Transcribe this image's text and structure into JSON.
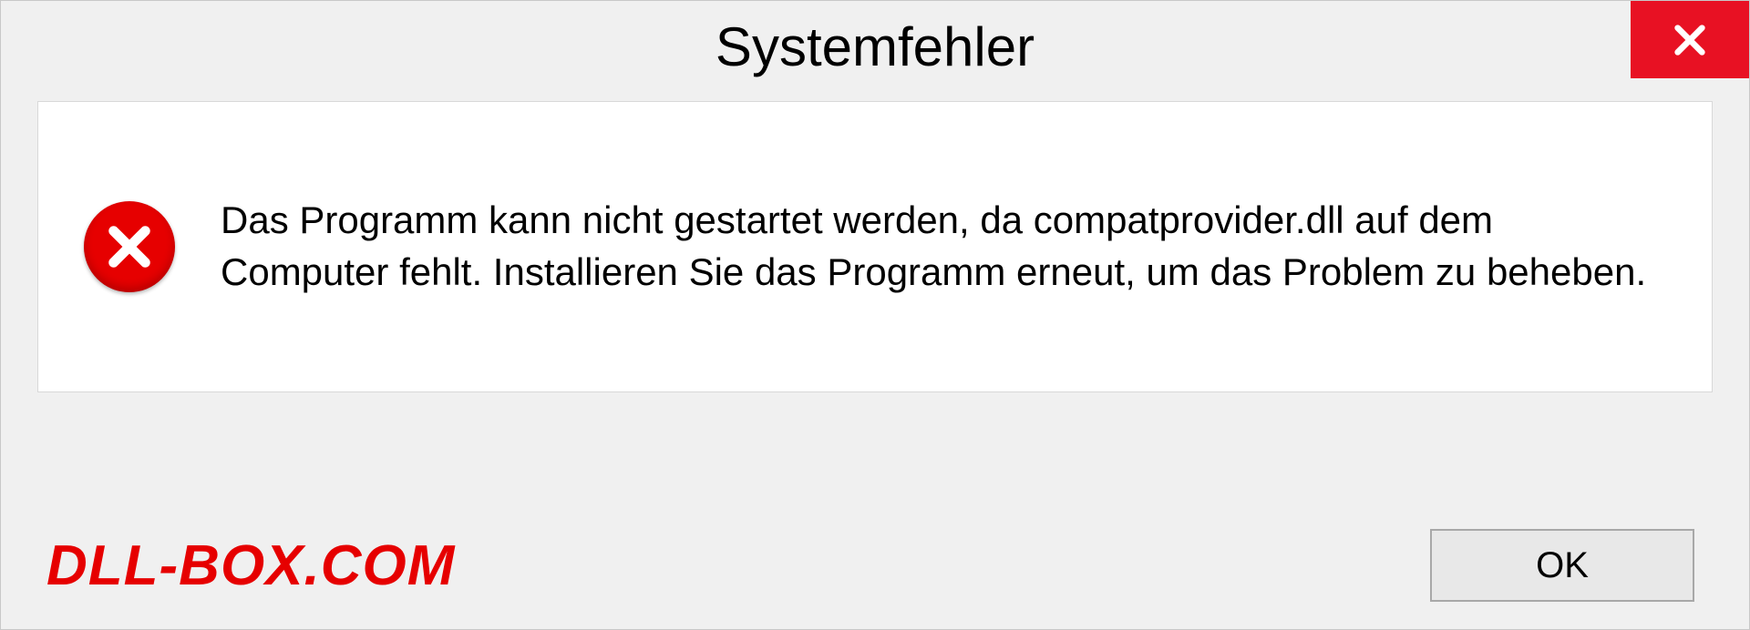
{
  "dialog": {
    "title": "Systemfehler",
    "message": "Das Programm kann nicht gestartet werden, da compatprovider.dll auf dem Computer fehlt. Installieren Sie das Programm erneut, um das Problem zu beheben.",
    "ok_label": "OK"
  },
  "watermark": "DLL-BOX.COM",
  "colors": {
    "close_bg": "#e81123",
    "error_red": "#e60000"
  }
}
